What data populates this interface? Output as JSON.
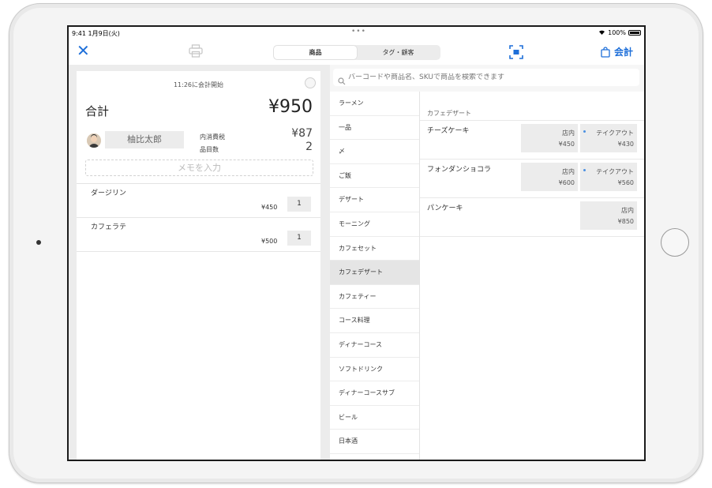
{
  "status_bar": {
    "time": "9:41  1月9日(火)",
    "battery": "100%"
  },
  "nav": {
    "tabs": [
      {
        "label": "商品",
        "active": true
      },
      {
        "label": "タグ・顧客",
        "active": false
      }
    ],
    "checkout_label": "会計",
    "accent_color": "#1e6fd9"
  },
  "order": {
    "session_start": "11:26に会計開始",
    "total_label": "合計",
    "total_value": "¥950",
    "customer_name": "柚比太郎",
    "tax_label": "内消費税",
    "tax_value": "¥87",
    "count_label": "品目数",
    "count_value": "2",
    "memo_placeholder": "メモを入力",
    "items": [
      {
        "name": "ダージリン",
        "price": "¥450",
        "qty": "1"
      },
      {
        "name": "カフェラテ",
        "price": "¥500",
        "qty": "1"
      }
    ]
  },
  "search": {
    "placeholder": "バーコードや商品名、SKUで商品を検索できます"
  },
  "categories": [
    {
      "label": "ラーメン"
    },
    {
      "label": "一品"
    },
    {
      "label": "〆"
    },
    {
      "label": "ご飯"
    },
    {
      "label": "デザート"
    },
    {
      "label": "モーニング"
    },
    {
      "label": "カフェセット"
    },
    {
      "label": "カフェデザート",
      "selected": true
    },
    {
      "label": "カフェティー"
    },
    {
      "label": "コース料理"
    },
    {
      "label": "ディナーコース"
    },
    {
      "label": "ソフトドリンク"
    },
    {
      "label": "ディナーコースサブ"
    },
    {
      "label": "ビール"
    },
    {
      "label": "日本酒"
    }
  ],
  "products": {
    "category_title": "カフェデザート",
    "items": [
      {
        "name": "チーズケーキ",
        "prices": [
          {
            "label": "店内",
            "price": "¥450"
          },
          {
            "label": "テイクアウト",
            "price": "¥430"
          }
        ]
      },
      {
        "name": "フォンダンショコラ",
        "prices": [
          {
            "label": "店内",
            "price": "¥600"
          },
          {
            "label": "テイクアウト",
            "price": "¥560"
          }
        ]
      },
      {
        "name": "パンケーキ",
        "prices": [
          {
            "label": "店内",
            "price": "¥850"
          }
        ]
      }
    ]
  }
}
